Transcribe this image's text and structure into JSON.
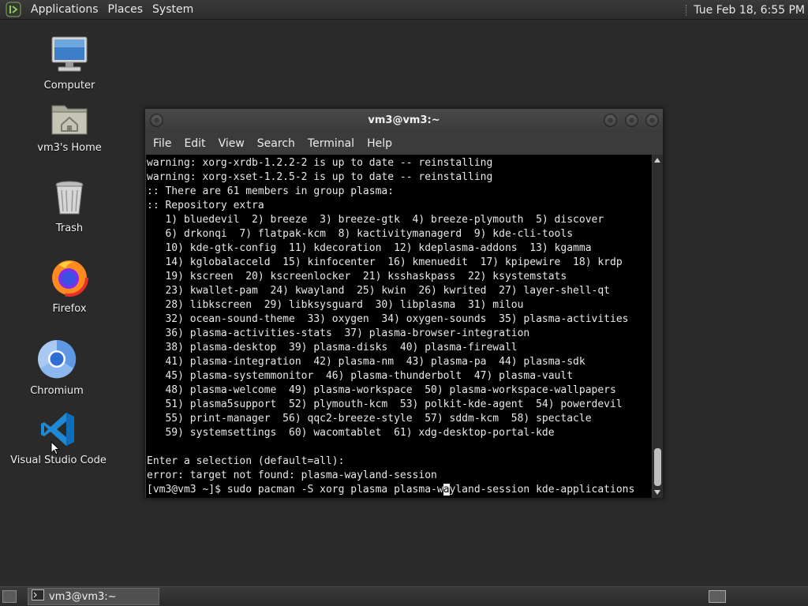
{
  "top_panel": {
    "menus": [
      "Applications",
      "Places",
      "System"
    ],
    "clock": "Tue Feb 18,  6:55 PM",
    "logo_icon": "mate-logo-icon"
  },
  "desktop": {
    "icons": [
      {
        "label": "Computer",
        "icon": "computer-icon"
      },
      {
        "label": "vm3's Home",
        "icon": "home-folder-icon"
      },
      {
        "label": "Trash",
        "icon": "trash-icon"
      },
      {
        "label": "Firefox",
        "icon": "firefox-icon"
      },
      {
        "label": "Chromium",
        "icon": "chromium-icon"
      },
      {
        "label": "Visual Studio Code",
        "icon": "vscode-icon"
      }
    ]
  },
  "terminal": {
    "title": "vm3@vm3:~",
    "menu": [
      "File",
      "Edit",
      "View",
      "Search",
      "Terminal",
      "Help"
    ],
    "lines": [
      "warning: xorg-xrdb-1.2.2-2 is up to date -- reinstalling",
      "warning: xorg-xset-1.2.5-2 is up to date -- reinstalling",
      ":: There are 61 members in group plasma:",
      ":: Repository extra",
      "   1) bluedevil  2) breeze  3) breeze-gtk  4) breeze-plymouth  5) discover",
      "   6) drkonqi  7) flatpak-kcm  8) kactivitymanagerd  9) kde-cli-tools",
      "   10) kde-gtk-config  11) kdecoration  12) kdeplasma-addons  13) kgamma",
      "   14) kglobalacceld  15) kinfocenter  16) kmenuedit  17) kpipewire  18) krdp",
      "   19) kscreen  20) kscreenlocker  21) ksshaskpass  22) ksystemstats",
      "   23) kwallet-pam  24) kwayland  25) kwin  26) kwrited  27) layer-shell-qt",
      "   28) libkscreen  29) libksysguard  30) libplasma  31) milou",
      "   32) ocean-sound-theme  33) oxygen  34) oxygen-sounds  35) plasma-activities",
      "   36) plasma-activities-stats  37) plasma-browser-integration",
      "   38) plasma-desktop  39) plasma-disks  40) plasma-firewall",
      "   41) plasma-integration  42) plasma-nm  43) plasma-pa  44) plasma-sdk",
      "   45) plasma-systemmonitor  46) plasma-thunderbolt  47) plasma-vault",
      "   48) plasma-welcome  49) plasma-workspace  50) plasma-workspace-wallpapers",
      "   51) plasma5support  52) plymouth-kcm  53) polkit-kde-agent  54) powerdevil",
      "   55) print-manager  56) qqc2-breeze-style  57) sddm-kcm  58) spectacle",
      "   59) systemsettings  60) wacomtablet  61) xdg-desktop-portal-kde",
      "",
      "Enter a selection (default=all):",
      "error: target not found: plasma-wayland-session"
    ],
    "prompt_before_cursor": "[vm3@vm3 ~]$ sudo pacman -S xorg plasma plasma-w",
    "prompt_cursor_char": "a",
    "prompt_after_cursor": "yland-session kde-applications"
  },
  "taskbar": {
    "task_label": "vm3@vm3:~",
    "task_icon": "terminal-icon",
    "show_desktop_icon": "show-desktop-icon",
    "workspace_icon": "workspace-switcher-icon"
  }
}
